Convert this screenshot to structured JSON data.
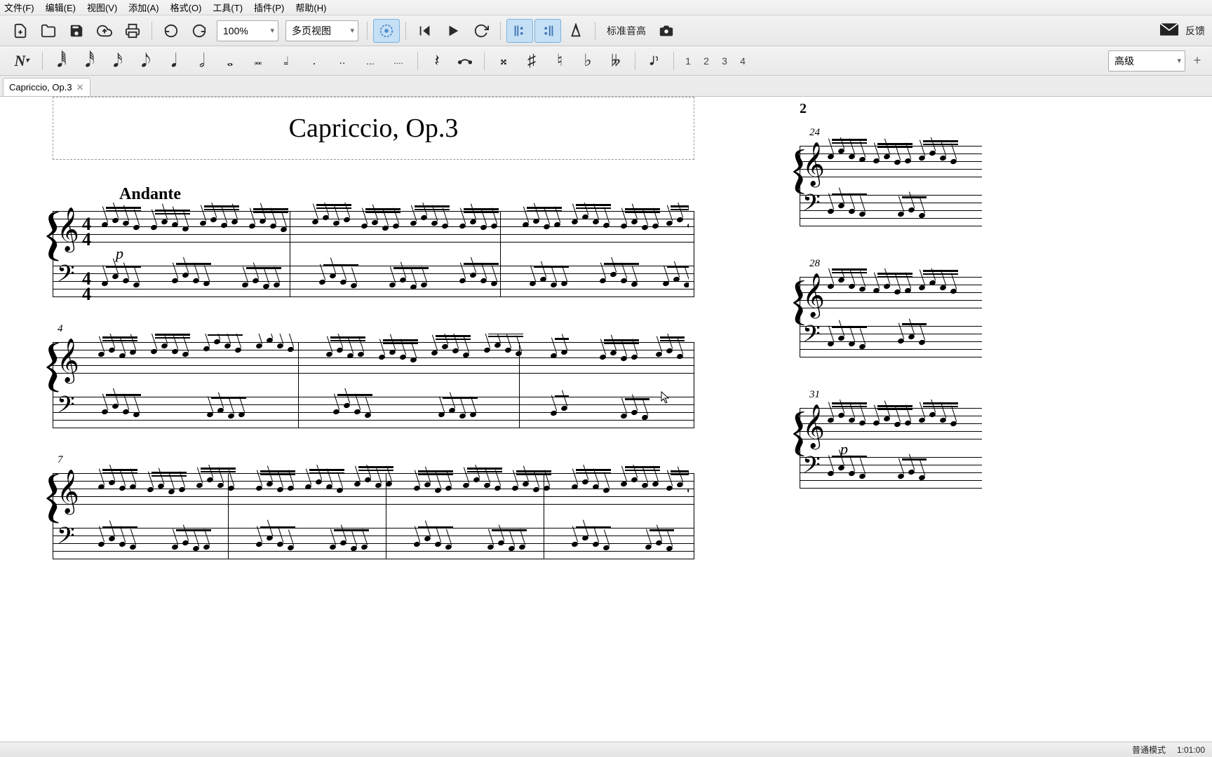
{
  "menu": {
    "file": "文件(F)",
    "edit": "编辑(E)",
    "view": "视图(V)",
    "add": "添加(A)",
    "format": "格式(O)",
    "tools": "工具(T)",
    "plugins": "插件(P)",
    "help": "帮助(H)"
  },
  "toolbar1": {
    "zoom": "100%",
    "view_mode": "多页视图",
    "pitch_label": "标准音高",
    "feedback": "反馈"
  },
  "toolbar2": {
    "voice1": "1",
    "voice2": "2",
    "voice3": "3",
    "voice4": "4",
    "workspace_combo": "高级"
  },
  "tab": {
    "label": "Capriccio, Op.3"
  },
  "score": {
    "title": "Capriccio, Op.3",
    "tempo": "Andante",
    "dynamic": "p",
    "time_sig_top": "4",
    "time_sig_bot": "4",
    "measure_nums_page1": [
      "4",
      "7"
    ],
    "page2_number": "2",
    "measure_nums_page2": [
      "24",
      "28",
      "31"
    ],
    "dynamic_page2": "p"
  },
  "status": {
    "mode": "普通模式",
    "time": "1:01:00"
  }
}
